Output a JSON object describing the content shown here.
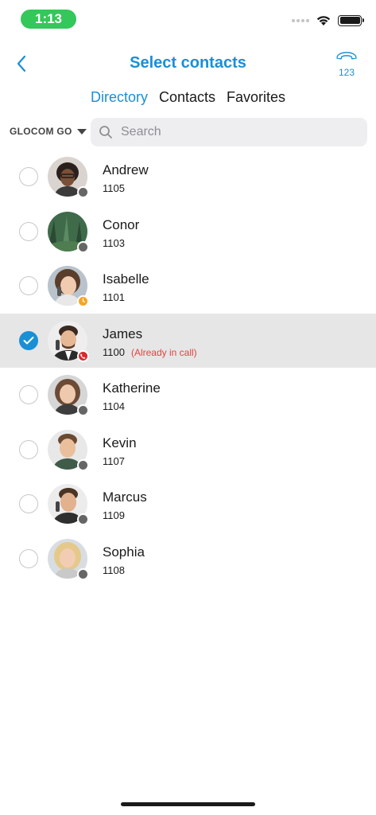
{
  "status_bar": {
    "time": "1:13",
    "time_color": "#34c759"
  },
  "nav": {
    "title": "Select contacts",
    "back_icon": "chevron-left-icon",
    "dialpad_icon": "phone-dialpad-icon",
    "dialpad_digits": "123"
  },
  "tabs": [
    {
      "label": "Directory",
      "active": true
    },
    {
      "label": "Contacts",
      "active": false
    },
    {
      "label": "Favorites",
      "active": false
    }
  ],
  "filter": {
    "source": "GLOCOM GO",
    "search_placeholder": "Search"
  },
  "contacts": [
    {
      "name": "Andrew",
      "ext": "1105",
      "note": "",
      "selected": false,
      "status": "offline",
      "status_color": "#666666"
    },
    {
      "name": "Conor",
      "ext": "1103",
      "note": "",
      "selected": false,
      "status": "offline",
      "status_color": "#666666"
    },
    {
      "name": "Isabelle",
      "ext": "1101",
      "note": "",
      "selected": false,
      "status": "away",
      "status_color": "#f5a623"
    },
    {
      "name": "James",
      "ext": "1100",
      "note": "(Already in call)",
      "selected": true,
      "status": "on-call",
      "status_color": "#e0262b"
    },
    {
      "name": "Katherine",
      "ext": "1104",
      "note": "",
      "selected": false,
      "status": "offline",
      "status_color": "#666666"
    },
    {
      "name": "Kevin",
      "ext": "1107",
      "note": "",
      "selected": false,
      "status": "offline",
      "status_color": "#666666"
    },
    {
      "name": "Marcus",
      "ext": "1109",
      "note": "",
      "selected": false,
      "status": "offline",
      "status_color": "#666666"
    },
    {
      "name": "Sophia",
      "ext": "1108",
      "note": "",
      "selected": false,
      "status": "offline",
      "status_color": "#666666"
    }
  ],
  "colors": {
    "accent": "#1a8fd6",
    "selected_row": "#e6e6e6",
    "alert": "#e0433e"
  }
}
